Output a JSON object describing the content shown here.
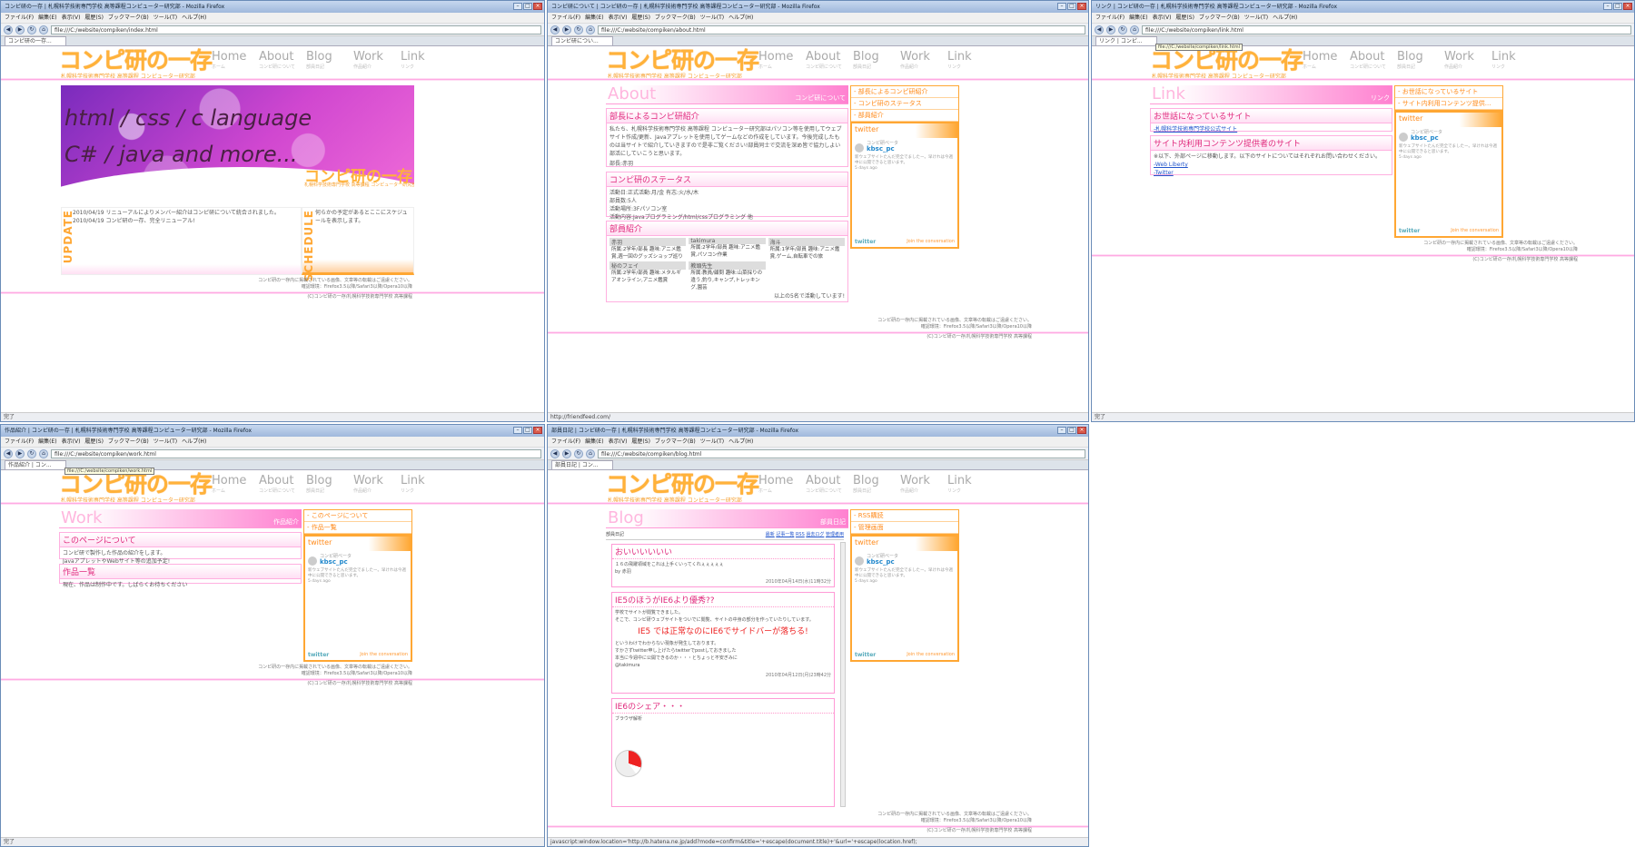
{
  "menu": [
    "ファイル(F)",
    "編集(E)",
    "表示(V)",
    "履歴(S)",
    "ブックマーク(B)",
    "ツール(T)",
    "ヘルプ(H)"
  ],
  "site": {
    "logo": "コンピ研の一存",
    "logo_sub": "札幌科学技術専門学校 高等課程 コンピューター研究部",
    "nav": [
      {
        "en": "Home",
        "jp": "ホーム"
      },
      {
        "en": "About",
        "jp": "コンピ研について"
      },
      {
        "en": "Blog",
        "jp": "部員日記"
      },
      {
        "en": "Work",
        "jp": "作品紹介"
      },
      {
        "en": "Link",
        "jp": "リンク"
      }
    ],
    "footer1": "コンピ研の一存内に掲載されている画像、文章等の転載はご遠慮ください。",
    "footer2": "確認環境：Firefox3.5以降/Safari3以降/Opera10以降",
    "footer3": "(C)コンピ研の一存/札幌科学技術専門学校 高等課程"
  },
  "twitter": {
    "title": "twitter",
    "name": "コンピ研ベータ",
    "handle": "kbsc_pc",
    "body": "新ウェブサイトたんだ完全でましたー。早けれは今週中に公開できると思います。",
    "time": "5 days ago",
    "join": "Join the conversation",
    "logo": "twitter"
  },
  "w1": {
    "title": "コンピ研の一存 | 札幌科学技術専門学校 高等課程コンピューター研究部 - Mozilla Firefox",
    "url": "file:///C:/website/compiken/index.html",
    "tab": "コンピ研の一存...",
    "status": "完了",
    "hero1": "html / css / c language",
    "hero2": "C# / java and more...",
    "update_label": "UPDATE",
    "update1": "2010/04/19 リニューアルによりメンバー紹介はコンピ研について統合されました。",
    "update2": "2010/04/19 コンピ研の一存、完全リニューアル!",
    "schedule_label": "SCHEDULE",
    "schedule": "何らかの予定があるとここにスケジュールを表示します。"
  },
  "w2": {
    "title": "コンピ研について | コンピ研の一存 | 札幌科学技術専門学校 高等課程コンピューター研究部 - Mozilla Firefox",
    "url": "file:///C:/website/compiken/about.html",
    "tab": "コンピ研につい...",
    "status": "http://friendfeed.com/",
    "page_title": "About",
    "page_sub": "コンピ研について",
    "side": [
      "- 部長によるコンピ研紹介",
      "- コンピ研のステータス",
      "- 部員紹介"
    ],
    "s1_h": "部長によるコンピ研紹介",
    "s1_t": "私たち、札幌科学技術専門学校 高等課程 コンピューター研究部はパソコン等を使用してウェブサイト作成/更新、Javaアプレットを使用してゲームなどの作成をしています。今後完成したものは当サイトで紹介していきますので是非ご覧ください!部員同士で交流を深め皆で協力しよい部活にしていこうと思います。",
    "s1_sign": "部長:赤羽",
    "s2_h": "コンピ研のステータス",
    "s2_lines": [
      "活動日:正式活動:月/金 有志:火/水/木",
      "部員数:5人",
      "活動場所:3Fパソコン室",
      "活動内容:Javaプログラミング/html/cssプログラミング 他"
    ],
    "s3_h": "部員紹介",
    "members": [
      {
        "name": "赤羽",
        "info": "所属:2学年/部長 趣味:アニメ鑑賞,週一回のグッズショップ巡り"
      },
      {
        "name": "takimura",
        "info": "所属:2学年/部員 趣味:アニメ鑑賞,パソコン作業"
      },
      {
        "name": "海斗",
        "info": "所属:1学年/部員 趣味:アニメ鑑賞,ゲーム,自転車での旅"
      },
      {
        "name": "秘のフェイ",
        "info": "所属:2学年/部員 趣味:メタルギアオンライン,アニメ鑑賞"
      },
      {
        "name": "教頭先生",
        "info": "所属:教員/顧問 趣味:山菜採りの違う,釣り,キャンプ,トレッキング,園芸"
      }
    ],
    "members_note": "以上の5名で活動しています!"
  },
  "w3": {
    "title": "リンク | コンピ研の一存 | 札幌科学技術専門学校 高等課程コンピューター研究部 - Mozilla Firefox",
    "url": "file:///C:/website/compiken/link.html",
    "tab": "リンク | コンピ...",
    "tooltip": "file:///C:/website/compiken/link.html",
    "status": "完了",
    "page_title": "Link",
    "page_sub": "リンク",
    "side": [
      "- お世話になっているサイト",
      "- サイト内利用コンテンツ提供..."
    ],
    "s1_h": "お世話になっているサイト",
    "s1_link": "-札幌科学技術専門学校公式サイト",
    "s2_h": "サイト内利用コンテンツ提供者のサイト",
    "s2_t": "※以下、外部ページに移動します。以下のサイトについてはそれぞれお問い合わせください。",
    "s2_links": [
      "-Web Liberty",
      "-Twitter"
    ]
  },
  "w4": {
    "title": "作品紹介 | コンピ研の一存 | 札幌科学技術専門学校 高等課程コンピューター研究部 - Mozilla Firefox",
    "url": "file:///C:/website/compiken/work.html",
    "tab": "作品紹介 | コン...",
    "tooltip": "file:///C:/website/compiken/work.html",
    "status": "完了",
    "page_title": "Work",
    "page_sub": "作品紹介",
    "side": [
      "- このページについて",
      "- 作品一覧"
    ],
    "s1_h": "このページについて",
    "s1_t1": "コンピ研で製作した作品の紹介をします。",
    "s1_t2": "JavaアプレットやWebサイト等の追加予定!",
    "s2_h": "作品一覧",
    "s2_t": "現在、作品は制作中です。しばらくお待ちください"
  },
  "w5": {
    "title": "部員日記 | コンピ研の一存 | 札幌科学技術専門学校 高等課程コンピューター研究部 - Mozilla Firefox",
    "url": "file:///C:/website/compiken/blog.html",
    "tab": "部員日記 | コン...",
    "status": "javascript:window.location='http://b.hatena.ne.jp/add?mode=confirm&title='+escape(document.title)+'&url='+escape(location.href);",
    "page_title": "Blog",
    "page_sub": "部員日記",
    "side": [
      "- RSS購読",
      "- 管理画面"
    ],
    "blog_name": "部員日記",
    "blog_links": [
      "最新",
      "記事一覧",
      "RSS",
      "過去ログ",
      "管理者用"
    ],
    "p1_h": "おいいいいいい",
    "p1_t": "１６の飛躍領域をこれは上手くいってくれぇぇぇぇぇ",
    "p1_by": "by 赤羽",
    "p1_d": "2010年04月14日(水)11時32分",
    "p2_h": "IE5のほうがIE6より優秀??",
    "p2_t1": "学校でサイトが閲覧できました。",
    "p2_t2": "そこで、コンピ研ウェブサイトをついでに閲覧、サイトの中身の部分を作っていたりしています。",
    "p2_big": "IE5 では正常なのにIE6でサイドバーが落ちる!",
    "p2_t3": "というわけでわからない現象が発生しております。",
    "p2_t4": "すかさずtwitter申し上げたらtwitterでpostしておきました",
    "p2_t5": "本当に今週中に公開できるのか・・・とちょっと不安ぎみに",
    "p2_by": "@takimura",
    "p2_d": "2010年04月12日(月)23時42分",
    "p3_h": "IE6のシェア・・・",
    "p3_t": "ブラウザ解析"
  }
}
